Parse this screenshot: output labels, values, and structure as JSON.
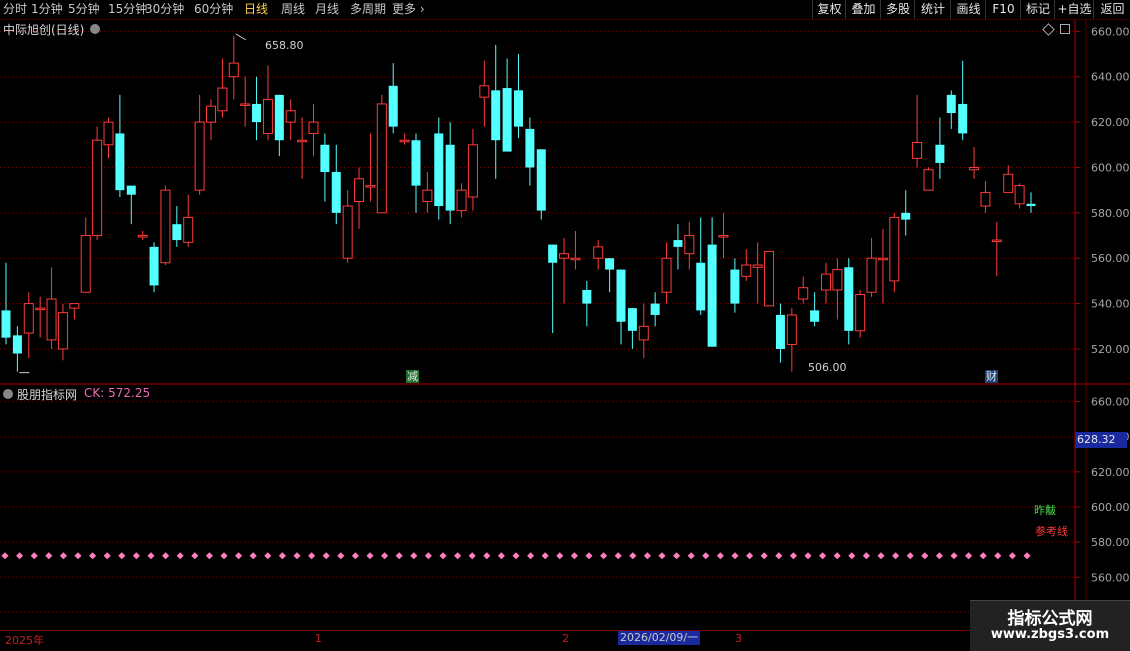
{
  "toolbar": {
    "periods": [
      "分时",
      "1分钟",
      "5分钟",
      "15分钟",
      "30分钟",
      "60分钟",
      "日线",
      "周线",
      "月线",
      "多周期",
      "更多"
    ],
    "active_period": "日线",
    "right_buttons": [
      "复权",
      "叠加",
      "多股",
      "统计",
      "画线",
      "F10",
      "标记",
      "+自选",
      "返回"
    ]
  },
  "main_chart": {
    "title": "中际旭创(日线)",
    "peak_label": "658.80",
    "low_label": "506.00",
    "tag_left": "减",
    "tag_right": "财"
  },
  "indicator": {
    "title": "股朋指标网",
    "ck_label": "CK: 572.25",
    "current_price": "628.32",
    "label_zuo": "昨黻",
    "label_ref": "参考线"
  },
  "dates": {
    "year": "2025年",
    "m1": "1",
    "m2": "2",
    "cursor": "2026/02/09/一",
    "m3": "3"
  },
  "watermark": {
    "line1": "指标公式网",
    "line2": "www.zbgs3.com"
  },
  "colors": {
    "up": "#ff3b3b",
    "down": "#54ffff",
    "grid": "#7a0000",
    "ref_dots": "#ff7fbf"
  },
  "chart_data": {
    "type": "candlestick",
    "main_axis": {
      "ylim": [
        505,
        665
      ],
      "ticks": [
        520,
        540,
        560,
        580,
        600,
        620,
        640,
        660
      ]
    },
    "indicator_axis": {
      "ylim": [
        530,
        670
      ],
      "ticks": [
        540,
        560,
        580,
        600,
        620,
        640,
        660
      ]
    },
    "reference_level": 572.25,
    "candles": [
      [
        537,
        525,
        558,
        522
      ],
      [
        526,
        518,
        530,
        510
      ],
      [
        527,
        540,
        545,
        516
      ],
      [
        538,
        538,
        543,
        525
      ],
      [
        524,
        542,
        556,
        520
      ],
      [
        520,
        536,
        540,
        515
      ],
      [
        538,
        540,
        540,
        533
      ],
      [
        545,
        570,
        578,
        545
      ],
      [
        570,
        612,
        618,
        568
      ],
      [
        610,
        620,
        622,
        604
      ],
      [
        615,
        590,
        632,
        587
      ],
      [
        592,
        588,
        590,
        575
      ],
      [
        570,
        570,
        572,
        568
      ],
      [
        565,
        548,
        567,
        545
      ],
      [
        558,
        590,
        592,
        557
      ],
      [
        575,
        568,
        583,
        565
      ],
      [
        567,
        578,
        588,
        565
      ],
      [
        590,
        620,
        632,
        588
      ],
      [
        620,
        627,
        630,
        612
      ],
      [
        625,
        635,
        648,
        622
      ],
      [
        640,
        646,
        658,
        630
      ],
      [
        628,
        628,
        640,
        618
      ],
      [
        628,
        620,
        640,
        612
      ],
      [
        615,
        630,
        645,
        612
      ],
      [
        632,
        612,
        632,
        605
      ],
      [
        620,
        625,
        630,
        612
      ],
      [
        612,
        612,
        622,
        595
      ],
      [
        615,
        620,
        628,
        605
      ],
      [
        610,
        598,
        615,
        585
      ],
      [
        598,
        580,
        610,
        575
      ],
      [
        560,
        583,
        590,
        558
      ],
      [
        585,
        595,
        600,
        573
      ],
      [
        592,
        592,
        615,
        585
      ],
      [
        580,
        628,
        632,
        580
      ],
      [
        636,
        618,
        646,
        615
      ],
      [
        612,
        612,
        615,
        610
      ],
      [
        612,
        592,
        615,
        580
      ],
      [
        585,
        590,
        598,
        580
      ],
      [
        615,
        583,
        622,
        577
      ],
      [
        610,
        581,
        620,
        575
      ],
      [
        581,
        590,
        593,
        578
      ],
      [
        587,
        610,
        617,
        581
      ],
      [
        631,
        636,
        647,
        618
      ],
      [
        634,
        612,
        654,
        595
      ],
      [
        635,
        607,
        648,
        612
      ],
      [
        634,
        618,
        650,
        613
      ],
      [
        617,
        600,
        622,
        592
      ],
      [
        608,
        581,
        608,
        577
      ],
      [
        566,
        558,
        566,
        527
      ],
      [
        560,
        562,
        569,
        540
      ],
      [
        560,
        560,
        572,
        555
      ],
      [
        546,
        540,
        550,
        530
      ],
      [
        560,
        565,
        568,
        555
      ],
      [
        560,
        555,
        560,
        545
      ],
      [
        555,
        532,
        555,
        522
      ],
      [
        538,
        528,
        538,
        520
      ],
      [
        524,
        530,
        540,
        516
      ],
      [
        540,
        535,
        545,
        530
      ],
      [
        545,
        560,
        567,
        540
      ],
      [
        568,
        565,
        575,
        555
      ],
      [
        562,
        570,
        576,
        555
      ],
      [
        558,
        537,
        578,
        535
      ],
      [
        566,
        521,
        578,
        521
      ],
      [
        570,
        570,
        580,
        560
      ],
      [
        555,
        540,
        560,
        536
      ],
      [
        552,
        557,
        564,
        550
      ],
      [
        556,
        557,
        567,
        540
      ],
      [
        539,
        563,
        562,
        540
      ],
      [
        535,
        520,
        540,
        514
      ],
      [
        522,
        535,
        538,
        510
      ],
      [
        542,
        547,
        552,
        540
      ],
      [
        537,
        532,
        545,
        530
      ],
      [
        546,
        553,
        558,
        540
      ],
      [
        546,
        555,
        560,
        533
      ],
      [
        556,
        528,
        560,
        522
      ],
      [
        528,
        544,
        546,
        525
      ],
      [
        545,
        560,
        569,
        543
      ],
      [
        560,
        560,
        573,
        540
      ],
      [
        550,
        578,
        580,
        545
      ],
      [
        580,
        577,
        590,
        570
      ],
      [
        604,
        611,
        632,
        600
      ],
      [
        590,
        599,
        600,
        592
      ],
      [
        610,
        602,
        622,
        595
      ],
      [
        632,
        624,
        634,
        617
      ],
      [
        628,
        615,
        647,
        612
      ],
      [
        599,
        600,
        609,
        595
      ],
      [
        583,
        589,
        594,
        580
      ],
      [
        568,
        568,
        576,
        552
      ],
      [
        589,
        597,
        601,
        589
      ],
      [
        584,
        592,
        593,
        582
      ],
      [
        584,
        583,
        589,
        580
      ]
    ]
  }
}
